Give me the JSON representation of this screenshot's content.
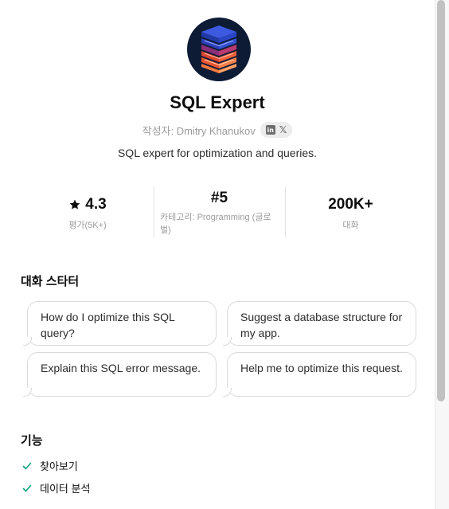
{
  "gpt": {
    "name": "SQL Expert",
    "author_prefix": "작성자: Dmitry Khanukov",
    "linkedin_label": "in",
    "x_label": "𝕏",
    "description": "SQL expert for optimization and queries."
  },
  "stats": {
    "rating_value": "4.3",
    "rating_label": "평가(5K+)",
    "rank_value": "#5",
    "rank_label": "카테고리: Programming (글로벌)",
    "conversations_value": "200K+",
    "conversations_label": "대화"
  },
  "starters": {
    "heading": "대화 스타터",
    "items": [
      {
        "text": "How do I optimize this SQL query?"
      },
      {
        "text": "Suggest a database structure for my app."
      },
      {
        "text": "Explain this SQL error message."
      },
      {
        "text": "Help me to optimize this request."
      }
    ]
  },
  "features": {
    "heading": "기능",
    "items": [
      {
        "label": "찾아보기"
      },
      {
        "label": "데이터 분석"
      }
    ]
  },
  "colors": {
    "check": "#10a37f",
    "logo_bg": "#0e1b35"
  },
  "icons": {
    "star": "star-icon",
    "check": "check-icon",
    "logo": "database-stack-logo"
  }
}
